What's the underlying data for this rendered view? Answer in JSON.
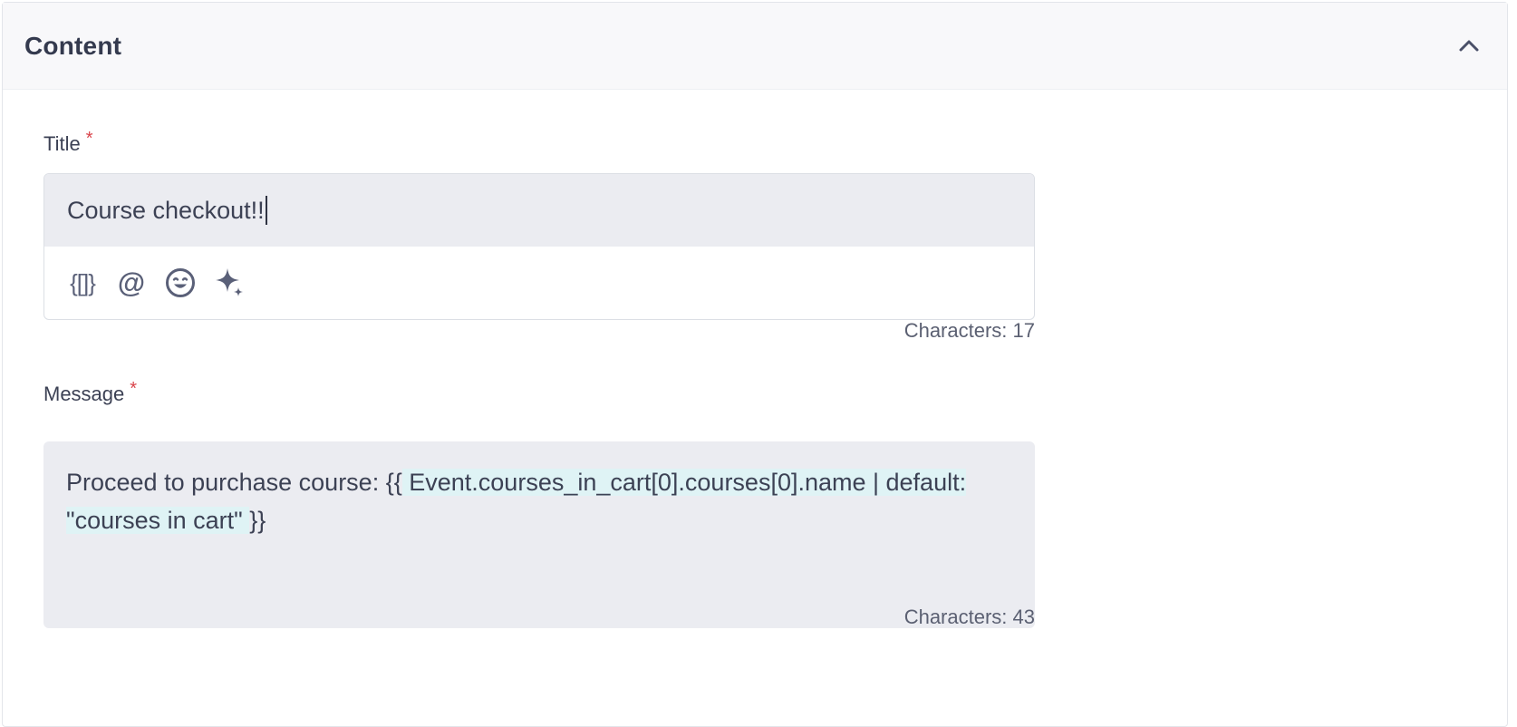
{
  "section": {
    "title": "Content"
  },
  "title_field": {
    "label": "Title",
    "required_mark": "*",
    "value": "Course checkout!!",
    "char_count": "Characters: 17",
    "toolbar": {
      "personalization_glyph": "{[]}",
      "mention_glyph": "@",
      "icons": [
        "personalization-icon",
        "mention-icon",
        "emoji-icon",
        "ai-sparkle-icon"
      ]
    }
  },
  "message_field": {
    "label": "Message",
    "required_mark": "*",
    "text_before": "Proceed to purchase course: ",
    "liquid_open": "{{",
    "liquid_body": " Event.courses_in_cart[0].courses[0].name | default: \"courses in cart\" ",
    "liquid_close": "}}",
    "char_count": "Characters: 43"
  },
  "colors": {
    "accent_icon": "#5a6078",
    "required": "#d9434a",
    "liquid_highlight": "#dff3f5",
    "input_bg": "#ebecf1"
  }
}
